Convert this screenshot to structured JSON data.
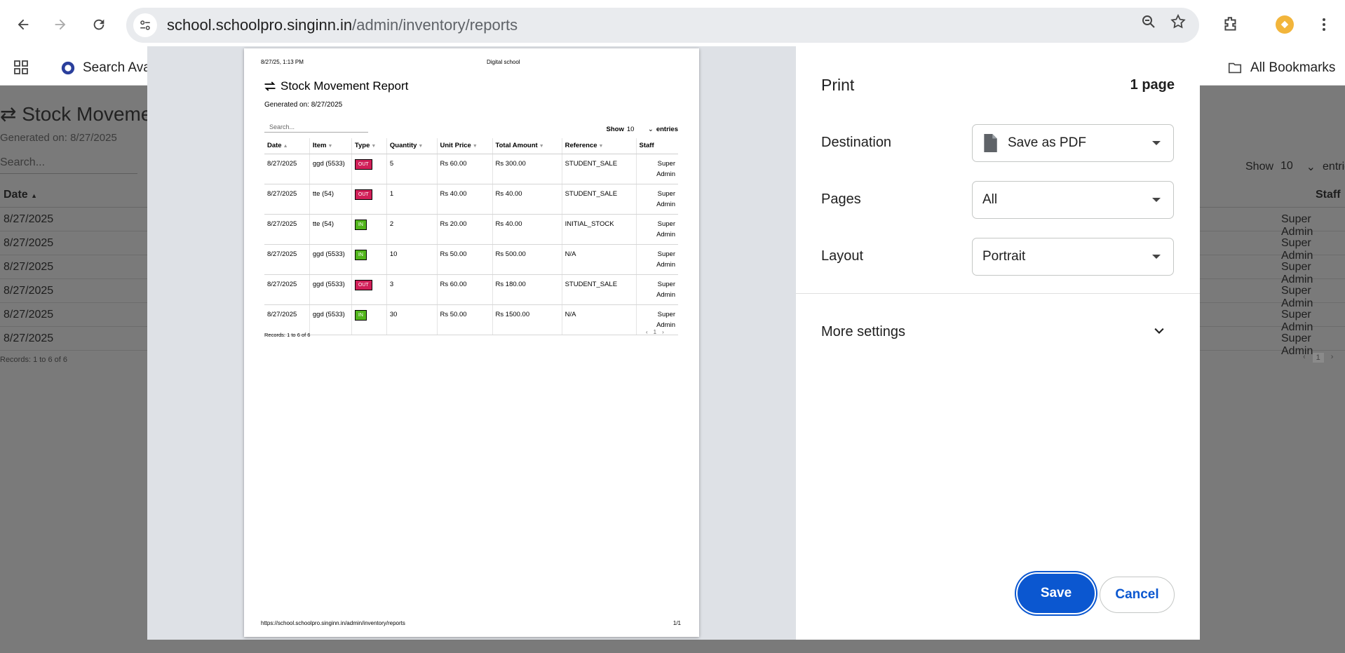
{
  "browser": {
    "url_host": "school.schoolpro.singinn.in",
    "url_path": "/admin/inventory/reports",
    "bookmarks": {
      "item1": "Search Avai",
      "all": "All Bookmarks"
    }
  },
  "background_page": {
    "title": "Stock Moveme",
    "generated": "Generated on: 8/27/2025",
    "search_placeholder": "Search...",
    "show_label": "Show",
    "show_value": "10",
    "entries_label": "entries",
    "col_date": "Date",
    "col_staff": "Staff",
    "rows": [
      {
        "date": "8/27/2025",
        "staff": "Super Admin"
      },
      {
        "date": "8/27/2025",
        "staff": "Super Admin"
      },
      {
        "date": "8/27/2025",
        "staff": "Super Admin"
      },
      {
        "date": "8/27/2025",
        "staff": "Super Admin"
      },
      {
        "date": "8/27/2025",
        "staff": "Super Admin"
      },
      {
        "date": "8/27/2025",
        "staff": "Super Admin"
      }
    ],
    "records": "Records: 1 to 6 of 6",
    "pager_page": "1"
  },
  "preview": {
    "header_datetime": "8/27/25, 1:13 PM",
    "header_title": "Digital school",
    "report_title": "Stock Movement Report",
    "generated": "Generated on: 8/27/2025",
    "search_placeholder": "Search...",
    "show_label": "Show",
    "show_value": "10",
    "entries_label": "entries",
    "columns": [
      "Date",
      "Item",
      "Type",
      "Quantity",
      "Unit Price",
      "Total Amount",
      "Reference",
      "Staff"
    ],
    "rows": [
      {
        "date": "8/27/2025",
        "item": "ggd (5533)",
        "type": "OUT",
        "qty": "5",
        "unit": "Rs 60.00",
        "total": "Rs 300.00",
        "ref": "STUDENT_SALE",
        "staff": "Super Admin"
      },
      {
        "date": "8/27/2025",
        "item": "tte (54)",
        "type": "OUT",
        "qty": "1",
        "unit": "Rs 40.00",
        "total": "Rs 40.00",
        "ref": "STUDENT_SALE",
        "staff": "Super Admin"
      },
      {
        "date": "8/27/2025",
        "item": "tte (54)",
        "type": "IN",
        "qty": "2",
        "unit": "Rs 20.00",
        "total": "Rs 40.00",
        "ref": "INITIAL_STOCK",
        "staff": "Super Admin"
      },
      {
        "date": "8/27/2025",
        "item": "ggd (5533)",
        "type": "IN",
        "qty": "10",
        "unit": "Rs 50.00",
        "total": "Rs 500.00",
        "ref": "N/A",
        "staff": "Super Admin"
      },
      {
        "date": "8/27/2025",
        "item": "ggd (5533)",
        "type": "OUT",
        "qty": "3",
        "unit": "Rs 60.00",
        "total": "Rs 180.00",
        "ref": "STUDENT_SALE",
        "staff": "Super Admin"
      },
      {
        "date": "8/27/2025",
        "item": "ggd (5533)",
        "type": "IN",
        "qty": "30",
        "unit": "Rs 50.00",
        "total": "Rs 1500.00",
        "ref": "N/A",
        "staff": "Super Admin"
      }
    ],
    "records": "Records: 1 to 6 of 6",
    "pager_prev": "‹",
    "pager_page": "1",
    "pager_next": "›",
    "footer_url": "https://school.schoolpro.singinn.in/admin/inventory/reports",
    "footer_page": "1/1"
  },
  "print_panel": {
    "title": "Print",
    "page_count": "1 page",
    "destination_label": "Destination",
    "destination_value": "Save as PDF",
    "pages_label": "Pages",
    "pages_value": "All",
    "layout_label": "Layout",
    "layout_value": "Portrait",
    "more_settings": "More settings",
    "save": "Save",
    "cancel": "Cancel"
  },
  "colors": {
    "accent": "#0b57d0",
    "badge_out": "#d11f58",
    "badge_in": "#52b51c"
  }
}
